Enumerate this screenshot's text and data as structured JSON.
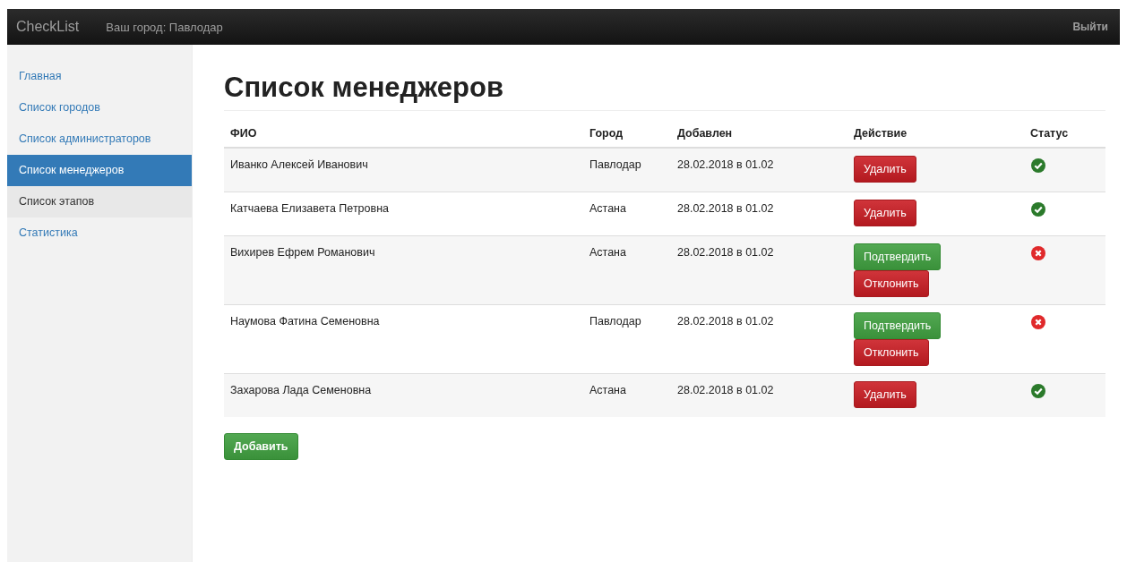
{
  "navbar": {
    "brand": "CheckList",
    "city": "Ваш город: Павлодар",
    "logout": "Выйти"
  },
  "sidebar": {
    "items": [
      {
        "label": "Главная",
        "selected": false,
        "hovered": false
      },
      {
        "label": "Список городов",
        "selected": false,
        "hovered": false
      },
      {
        "label": "Список администраторов",
        "selected": false,
        "hovered": false
      },
      {
        "label": "Список менеджеров",
        "selected": true,
        "hovered": false
      },
      {
        "label": "Список этапов",
        "selected": false,
        "hovered": true
      },
      {
        "label": "Статистика",
        "selected": false,
        "hovered": false
      }
    ]
  },
  "page": {
    "title": "Список менеджеров"
  },
  "table": {
    "columns": [
      "ФИО",
      "Город",
      "Добавлен",
      "Действие",
      "Статус"
    ],
    "rows": [
      {
        "name": "Иванко Алексей Иванович",
        "city": "Павлодар",
        "added": "28.02.2018 в 01.02",
        "actions": [
          {
            "kind": "danger",
            "label": "Удалить"
          }
        ],
        "confirmed": true
      },
      {
        "name": "Катчаева Елизавета Петровна",
        "city": "Астана",
        "added": "28.02.2018 в 01.02",
        "actions": [
          {
            "kind": "danger",
            "label": "Удалить"
          }
        ],
        "confirmed": true
      },
      {
        "name": "Вихирев Ефрем Романович",
        "city": "Астана",
        "added": "28.02.2018 в 01.02",
        "actions": [
          {
            "kind": "success",
            "label": "Подтвердить"
          },
          {
            "kind": "danger",
            "label": "Отклонить"
          }
        ],
        "confirmed": false
      },
      {
        "name": "Наумова Фатина Семеновна",
        "city": "Павлодар",
        "added": "28.02.2018 в 01.02",
        "actions": [
          {
            "kind": "success",
            "label": "Подтвердить"
          },
          {
            "kind": "danger",
            "label": "Отклонить"
          }
        ],
        "confirmed": false
      },
      {
        "name": "Захарова Лада Семеновна",
        "city": "Астана",
        "added": "28.02.2018 в 01.02",
        "actions": [
          {
            "kind": "danger",
            "label": "Удалить"
          }
        ],
        "confirmed": true
      }
    ]
  },
  "add_button": "Добавить"
}
